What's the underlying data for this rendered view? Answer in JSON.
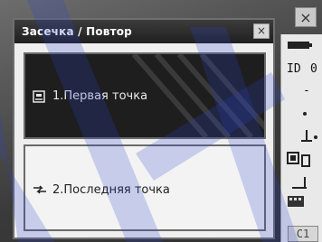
{
  "dialog": {
    "title": "Засечка / Повтор",
    "close_glyph": "×",
    "options": [
      {
        "label": "1.Первая точка",
        "icon": "point-box-icon",
        "selected": true
      },
      {
        "label": "2.Последняя точка",
        "icon": "arrow-link-icon",
        "selected": false
      }
    ]
  },
  "screen": {
    "close_glyph": "×",
    "side_panel": {
      "glyphs": [
        "ID",
        "0",
        "-"
      ],
      "bottom_tag": "C1"
    }
  },
  "colors": {
    "selected_bg": "#1e1e1e",
    "unselected_bg": "#f3f3f3",
    "titlebar": "#2a2a2a",
    "overlay_blue": "#2b46c8"
  }
}
